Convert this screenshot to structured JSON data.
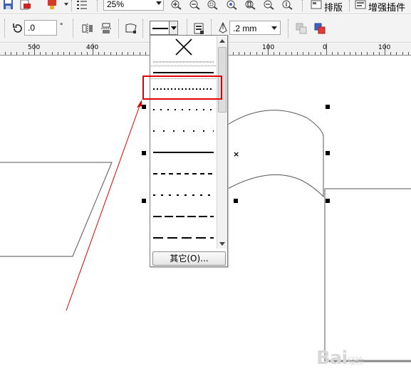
{
  "toolbar_top": {
    "icons": [
      "save-icon",
      "publish-pdf-icon",
      "application-launcher-icon",
      "options-icon",
      "zoom-in-icon",
      "zoom-out-icon",
      "zoom-selected-icon",
      "zoom-all-icon",
      "zoom-page-icon",
      "zoom-width-icon",
      "zoom-height-icon"
    ],
    "zoom_value": "25%",
    "layout_label": "排版",
    "plugins_label": "增强插件"
  },
  "toolbar_property": {
    "rotation_value": ".0",
    "degree_symbol": "°",
    "outline_width": ".2 mm"
  },
  "ruler": {
    "labels": [
      "500",
      "400",
      "100",
      "0",
      "100"
    ]
  },
  "outline_dropdown": {
    "styles": [
      "none",
      "thin-dotted",
      "solid",
      "fine-dotted",
      "dotted",
      "sparse-dotted",
      "dense-dashed",
      "dashed",
      "dash-dot",
      "long-dashed",
      "extra-long-dashed"
    ],
    "other_button": "其它(O)..."
  },
  "watermark_text": "Bai",
  "watermark_sub": "经验"
}
